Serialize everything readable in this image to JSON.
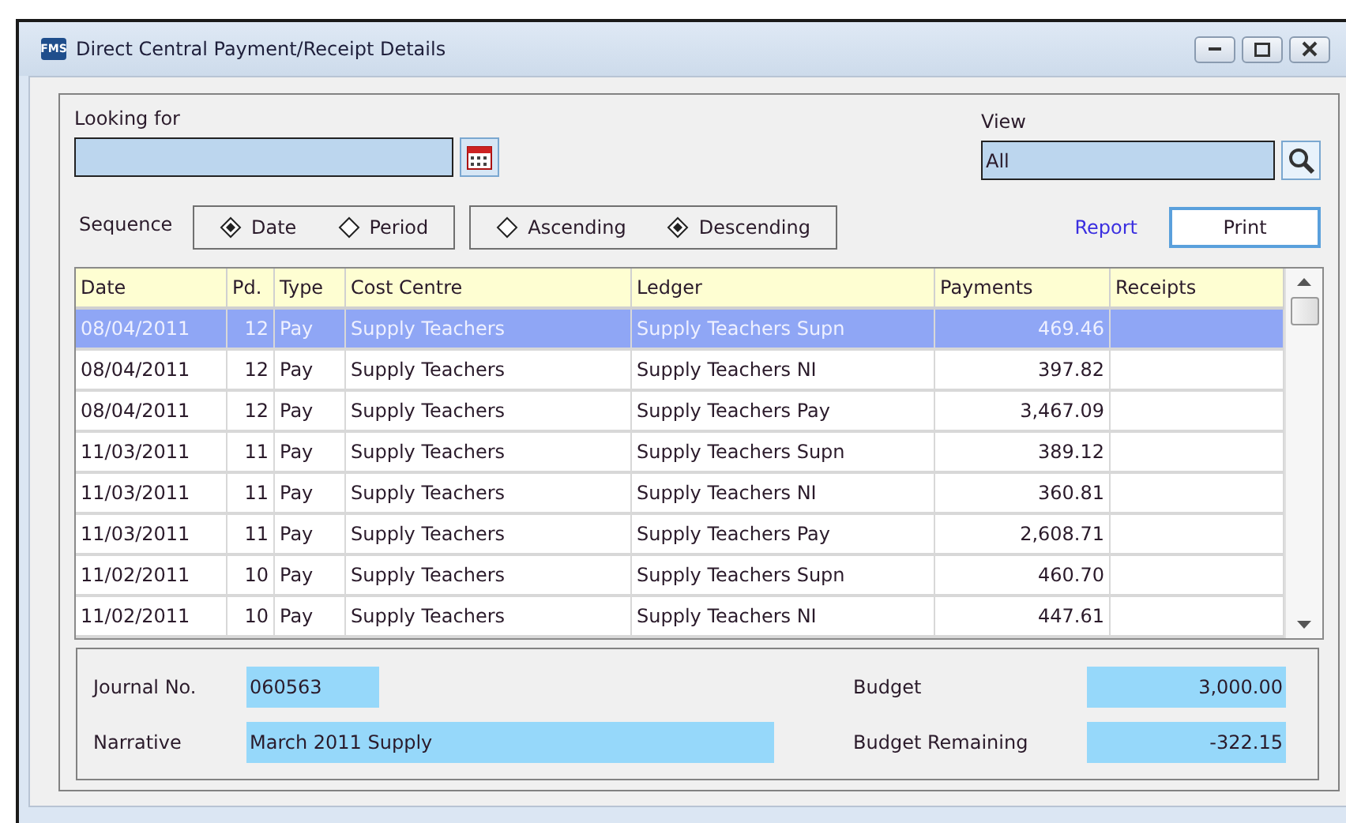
{
  "window": {
    "title": "Direct Central Payment/Receipt Details",
    "app_badge": "FMS"
  },
  "looking_for": {
    "label": "Looking for"
  },
  "view": {
    "label": "View",
    "value": "All"
  },
  "sequence": {
    "label": "Sequence",
    "groups": [
      [
        {
          "label": "Date",
          "selected": true
        },
        {
          "label": "Period",
          "selected": false
        }
      ],
      [
        {
          "label": "Ascending",
          "selected": false
        },
        {
          "label": "Descending",
          "selected": true
        }
      ]
    ]
  },
  "report_link": "Report",
  "print_button": "Print",
  "table": {
    "columns": [
      "Date",
      "Pd.",
      "Type",
      "Cost Centre",
      "Ledger",
      "Payments",
      "Receipts"
    ],
    "rows": [
      {
        "cells": [
          "08/04/2011",
          "12",
          "Pay",
          "Supply Teachers",
          "Supply Teachers Supn",
          "469.46",
          ""
        ],
        "selected": true
      },
      {
        "cells": [
          "08/04/2011",
          "12",
          "Pay",
          "Supply Teachers",
          "Supply Teachers NI",
          "397.82",
          ""
        ],
        "selected": false
      },
      {
        "cells": [
          "08/04/2011",
          "12",
          "Pay",
          "Supply Teachers",
          "Supply Teachers Pay",
          "3,467.09",
          ""
        ],
        "selected": false
      },
      {
        "cells": [
          "11/03/2011",
          "11",
          "Pay",
          "Supply Teachers",
          "Supply Teachers Supn",
          "389.12",
          ""
        ],
        "selected": false
      },
      {
        "cells": [
          "11/03/2011",
          "11",
          "Pay",
          "Supply Teachers",
          "Supply Teachers NI",
          "360.81",
          ""
        ],
        "selected": false
      },
      {
        "cells": [
          "11/03/2011",
          "11",
          "Pay",
          "Supply Teachers",
          "Supply Teachers Pay",
          "2,608.71",
          ""
        ],
        "selected": false
      },
      {
        "cells": [
          "11/02/2011",
          "10",
          "Pay",
          "Supply Teachers",
          "Supply Teachers Supn",
          "460.70",
          ""
        ],
        "selected": false
      },
      {
        "cells": [
          "11/02/2011",
          "10",
          "Pay",
          "Supply Teachers",
          "Supply Teachers NI",
          "447.61",
          ""
        ],
        "selected": false
      }
    ]
  },
  "details": {
    "journal_no": {
      "label": "Journal No.",
      "value": "060563"
    },
    "narrative": {
      "label": "Narrative",
      "value": "March 2011 Supply"
    },
    "budget": {
      "label": "Budget",
      "value": "3,000.00"
    },
    "budget_remaining": {
      "label": "Budget Remaining",
      "value": "-322.15"
    }
  }
}
